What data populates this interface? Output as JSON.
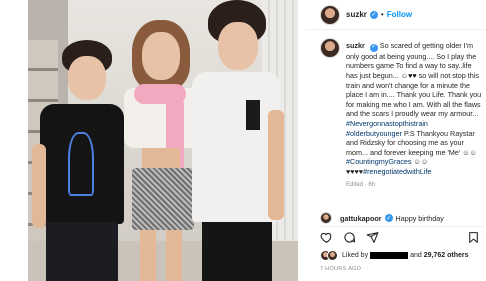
{
  "post": {
    "username": "suzkr",
    "follow_label": "Follow",
    "separator": "•",
    "verified_glyph": "✓"
  },
  "caption": {
    "username": "suzkr",
    "text_1": "So scared of getting older I'm only good at being young.... So I play the numbers game To find a way to say..life has just begun...",
    "text_2": "so will not stop this train and won't change for a minute the place I am in.... Thank you Life. Thank you for making me who I am. With all the flaws and the scars I proudly wear my armour...",
    "tag_1": "#Nevergonnastopthistrain",
    "tag_2": "#olderbutyounger",
    "text_3": "P.S Thankyou Raystar and Ridzsky for choosing me as your mom... and forever keeping me 'Me'",
    "tag_3": "#CountingmyGraces",
    "tag_4": "#renegotiatedwithLife",
    "edited": "Edited · 6h"
  },
  "comment": {
    "username": "gattukapoor",
    "text": "Happy birthday"
  },
  "actions": {
    "like_icon": "heart-icon",
    "comment_icon": "comment-icon",
    "share_icon": "share-icon",
    "save_icon": "bookmark-icon"
  },
  "likes": {
    "prefix": "Liked by",
    "and_label": "and",
    "count": "29,762 others"
  },
  "timestamp": "7 HOURS AGO",
  "colors": {
    "link": "#0095f6",
    "hashtag": "#00376b",
    "muted": "#8e8e8e",
    "verified": "#3897f0"
  }
}
